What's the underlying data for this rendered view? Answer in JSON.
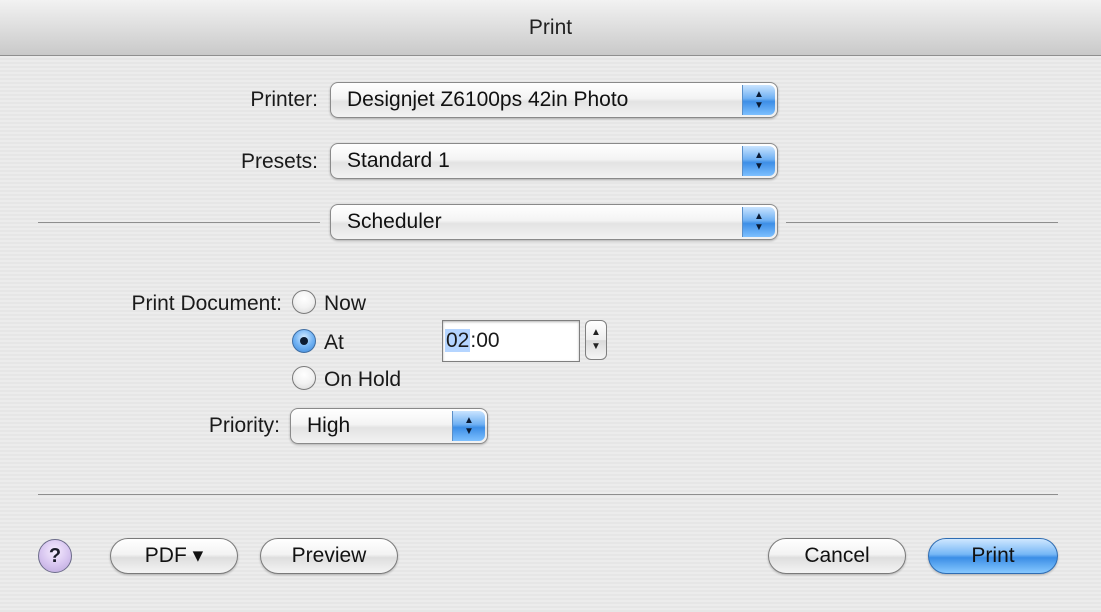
{
  "window": {
    "title": "Print"
  },
  "printer": {
    "label": "Printer:",
    "value": "Designjet Z6100ps 42in Photo"
  },
  "presets": {
    "label": "Presets:",
    "value": "Standard 1"
  },
  "panel": {
    "value": "Scheduler"
  },
  "schedule": {
    "label": "Print Document:",
    "options": [
      {
        "label": "Now",
        "selected": false
      },
      {
        "label": "At",
        "selected": true
      },
      {
        "label": "On Hold",
        "selected": false
      }
    ],
    "time_hour": "02",
    "time_sep": ":",
    "time_minute": "00"
  },
  "priority": {
    "label": "Priority:",
    "value": "High"
  },
  "footer": {
    "help_label": "?",
    "pdf_label": "PDF ▾",
    "preview_label": "Preview",
    "cancel_label": "Cancel",
    "print_label": "Print"
  },
  "icons": {
    "popup_arrows": "up-down-chevron-icon",
    "stepper": "stepper-arrows-icon",
    "help": "question-icon"
  },
  "colors": {
    "accent": "#3b8ee6",
    "selection": "#b5d5ff"
  }
}
